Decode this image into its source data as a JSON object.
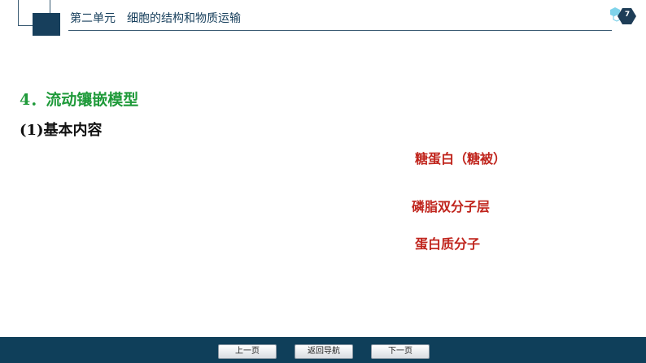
{
  "header": {
    "unit_title": "第二单元　细胞的结构和物质运输",
    "page_number": "7"
  },
  "content": {
    "heading": "4．流动镶嵌模型",
    "subheading": "(1)基本内容",
    "labels": [
      "糖蛋白（糖被）",
      "磷脂双分子层",
      "蛋白质分子"
    ]
  },
  "nav": {
    "prev_label": "上一页",
    "menu_label": "返回导航",
    "next_label": "下一页"
  },
  "colors": {
    "brand": "#173f5c",
    "heading": "#1f9a3a",
    "label": "#c0251d",
    "footer": "#0f3f5a"
  }
}
